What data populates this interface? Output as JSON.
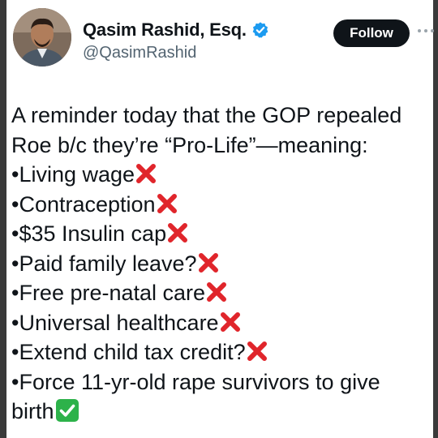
{
  "author": {
    "display_name": "Qasim Rashid, Esq.",
    "handle": "@QasimRashid",
    "verified": true,
    "avatar_icon": "person-avatar"
  },
  "actions": {
    "follow_label": "Follow",
    "more_icon": "more-horizontal-icon"
  },
  "tweet": {
    "intro_line_1": "A reminder today that the GOP repealed",
    "intro_line_2": "Roe b/c they’re “Pro-Life”—meaning:",
    "items": [
      {
        "bullet": "•",
        "text": "Living wage",
        "mark": "cross-mark"
      },
      {
        "bullet": "•",
        "text": "Contraception",
        "mark": "cross-mark"
      },
      {
        "bullet": "•",
        "text": "$35 Insulin cap",
        "mark": "cross-mark"
      },
      {
        "bullet": "•",
        "text": "Paid family leave?",
        "mark": "cross-mark"
      },
      {
        "bullet": "•",
        "text": "Free pre-natal care",
        "mark": "cross-mark"
      },
      {
        "bullet": "•",
        "text": "Universal healthcare",
        "mark": "cross-mark"
      },
      {
        "bullet": "•",
        "text": "Extend child tax credit?",
        "mark": "cross-mark"
      }
    ],
    "last_item": {
      "bullet": "•",
      "text_line_1": "Force 11-yr-old rape survivors to give",
      "text_line_2": "birth",
      "mark": "check-mark"
    }
  },
  "colors": {
    "verified_badge": "#1d9bf0",
    "follow_button_bg": "#0f1419",
    "cross_mark": "#e0252b",
    "check_mark_bg": "#2db24a"
  }
}
